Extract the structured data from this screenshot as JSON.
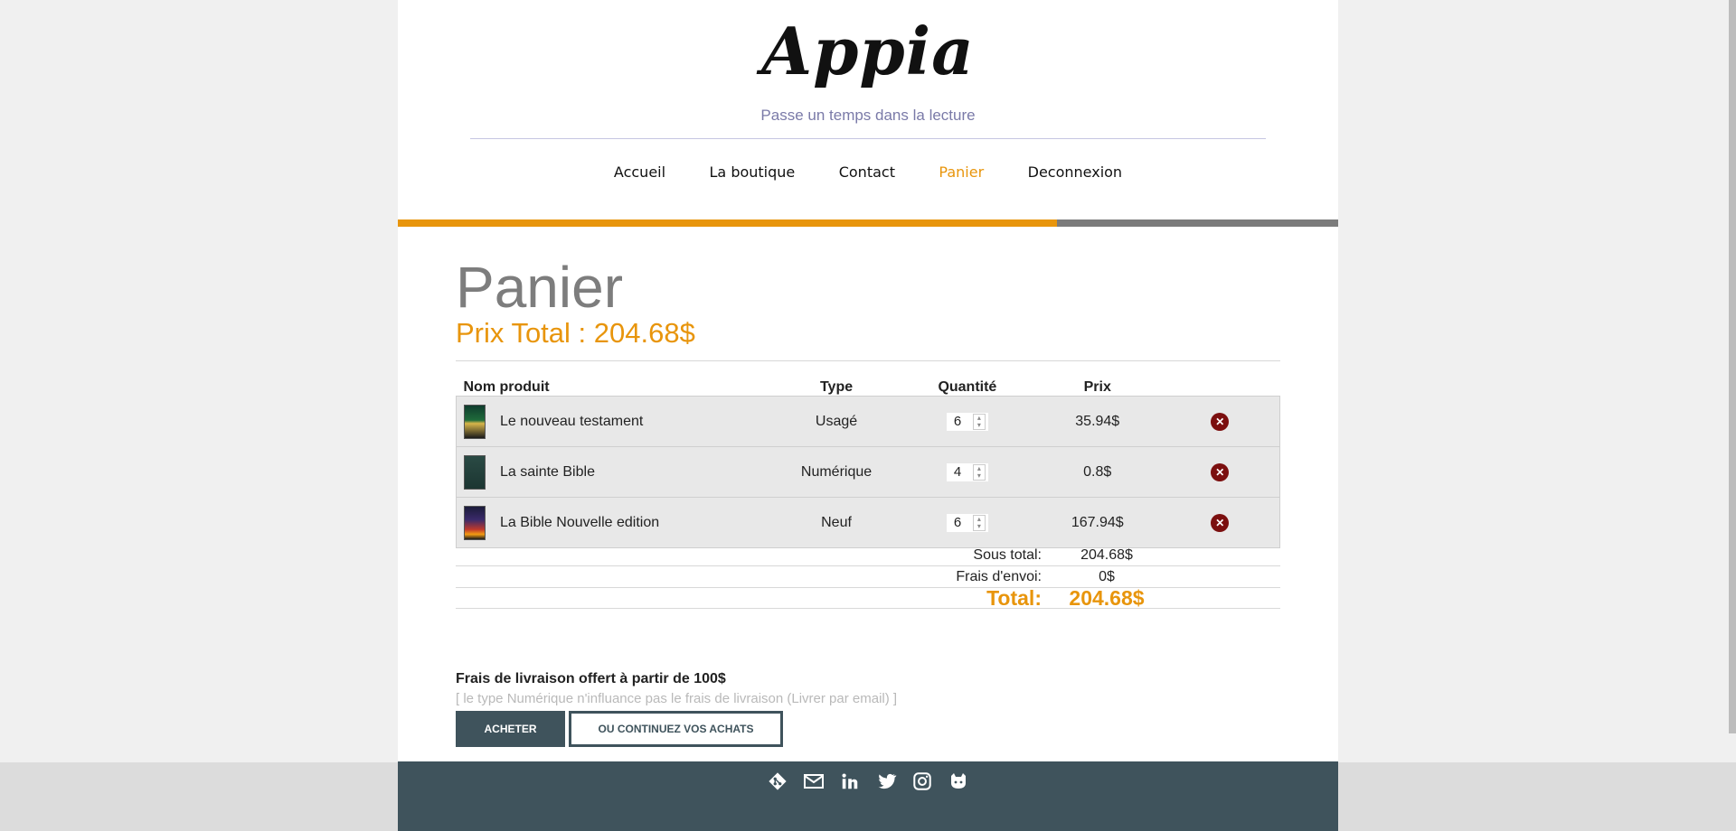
{
  "site": {
    "logo": "Appia",
    "tagline": "Passe un temps dans la lecture"
  },
  "nav": [
    {
      "label": "Accueil",
      "active": false
    },
    {
      "label": "La boutique",
      "active": false
    },
    {
      "label": "Contact",
      "active": false
    },
    {
      "label": "Panier",
      "active": true
    },
    {
      "label": "Deconnexion",
      "active": false
    }
  ],
  "cart": {
    "title": "Panier",
    "total_header": "Prix Total : 204.68$",
    "columns": {
      "name": "Nom produit",
      "type": "Type",
      "qty": "Quantité",
      "price": "Prix"
    },
    "items": [
      {
        "name": "Le nouveau testament",
        "type": "Usagé",
        "qty": "6",
        "price": "35.94$",
        "cover": "cover-dark-green"
      },
      {
        "name": "La sainte Bible",
        "type": "Numérique",
        "qty": "4",
        "price": "0.8$",
        "cover": "cover-teal"
      },
      {
        "name": "La Bible Nouvelle edition",
        "type": "Neuf",
        "qty": "6",
        "price": "167.94$",
        "cover": "cover-sunset"
      }
    ],
    "subtotal_label": "Sous total:",
    "subtotal_value": "204.68$",
    "shipping_label": "Frais d'envoi:",
    "shipping_value": "0$",
    "total_label": "Total:",
    "total_value": "204.68$"
  },
  "notice": {
    "title": "Frais de livraison offert à partir de 100$",
    "subtitle": "[ le type Numérique n'influance pas le frais de livraison (Livrer par email) ]"
  },
  "buttons": {
    "buy": "ACHETER",
    "continue": "OU CONTINUEZ VOS ACHATS"
  },
  "footer_icons": [
    "git-icon",
    "mail-icon",
    "linkedin-icon",
    "twitter-icon",
    "instagram-icon",
    "github-icon"
  ],
  "colors": {
    "accent": "#e8950c",
    "dark": "#3f535c",
    "delete": "#7b0f0f"
  }
}
